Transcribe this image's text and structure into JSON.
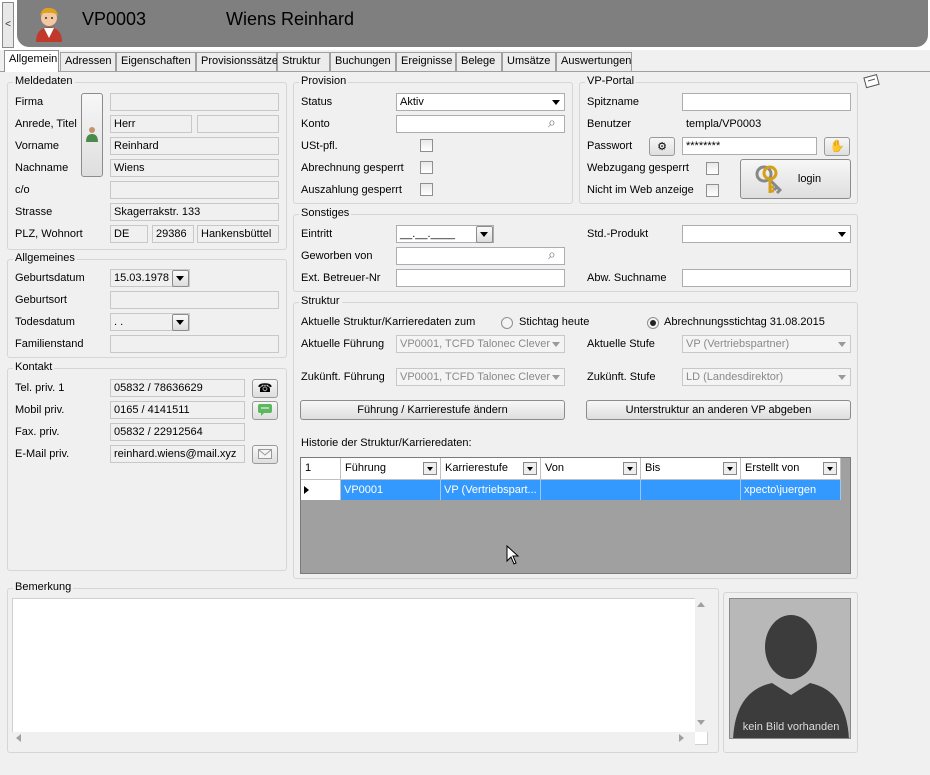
{
  "header": {
    "id": "VP0003",
    "name": "Wiens Reinhard",
    "collapse": "<"
  },
  "tabs": [
    "Allgemein",
    "Adressen",
    "Eigenschaften",
    "Provisionssätze",
    "Struktur",
    "Buchungen",
    "Ereignisse",
    "Belege",
    "Umsätze",
    "Auswertungen"
  ],
  "meldedaten": {
    "title": "Meldedaten",
    "firma_label": "Firma",
    "firma": "",
    "anrede_label": "Anrede, Titel",
    "anrede": "Herr",
    "titel": "",
    "vorname_label": "Vorname",
    "vorname": "Reinhard",
    "nachname_label": "Nachname",
    "nachname": "Wiens",
    "co_label": "c/o",
    "co": "",
    "strasse_label": "Strasse",
    "strasse": "Skagerrakstr. 133",
    "plz_label": "PLZ, Wohnort",
    "land": "DE",
    "plz": "29386",
    "ort": "Hankensbüttel"
  },
  "allgemeines": {
    "title": "Allgemeines",
    "geburtsdatum_label": "Geburtsdatum",
    "geburtsdatum": "15.03.1978",
    "geburtsort_label": "Geburtsort",
    "geburtsort": "",
    "todesdatum_label": "Todesdatum",
    "todesdatum": " .  .",
    "familienstand_label": "Familienstand",
    "familienstand": ""
  },
  "kontakt": {
    "title": "Kontakt",
    "tel_label": "Tel. priv. 1",
    "tel": "05832 / 78636629",
    "mobil_label": "Mobil priv.",
    "mobil": "0165 / 4141511",
    "fax_label": "Fax. priv.",
    "fax": "05832 / 22912564",
    "email_label": "E-Mail priv.",
    "email": "reinhard.wiens@mail.xyz"
  },
  "provision": {
    "title": "Provision",
    "status_label": "Status",
    "status": "Aktiv",
    "konto_label": "Konto",
    "konto": "",
    "ust_label": "USt-pfl.",
    "abrechnung_label": "Abrechnung gesperrt",
    "auszahlung_label": "Auszahlung gesperrt"
  },
  "portal": {
    "title": "VP-Portal",
    "spitzname_label": "Spitzname",
    "spitzname": "",
    "benutzer_label": "Benutzer",
    "benutzer": "templa/VP0003",
    "passwort_label": "Passwort",
    "passwort": "********",
    "webzugang_label": "Webzugang gesperrt",
    "nichtweb_label": "Nicht im Web anzeige",
    "login": "login"
  },
  "sonstiges": {
    "title": "Sonstiges",
    "eintritt_label": "Eintritt",
    "eintritt": "__.__.____",
    "geworben_label": "Geworben von",
    "geworben": "",
    "extbetreuer_label": "Ext. Betreuer-Nr",
    "extbetreuer": "",
    "stdprodukt_label": "Std.-Produkt",
    "stdprodukt": "",
    "abwsuchname_label": "Abw. Suchname",
    "abwsuchname": ""
  },
  "struktur": {
    "title": "Struktur",
    "aktuelle_zum_label": "Aktuelle Struktur/Karrieredaten zum",
    "radio_heute": "Stichtag heute",
    "radio_abrechnung": "Abrechnungsstichtag 31.08.2015",
    "fuehrung_label": "Aktuelle Führung",
    "fuehrung": "VP0001, TCFD Talonec Clever",
    "stufe_label": "Aktuelle Stufe",
    "stufe": "VP (Vertriebspartner)",
    "zfuehrung_label": "Zukünft. Führung",
    "zfuehrung": "VP0001, TCFD Talonec Clever",
    "zstufe_label": "Zukünft. Stufe",
    "zstufe": "LD (Landesdirektor)",
    "btn_aendern": "Führung / Karrierestufe ändern",
    "btn_abgeben": "Unterstruktur an anderen VP abgeben",
    "historie_label": "Historie der Struktur/Karrieredaten:"
  },
  "history": {
    "count": "1",
    "columns": [
      "Führung",
      "Karrierestufe",
      "Von",
      "Bis",
      "Erstellt von"
    ],
    "rows": [
      [
        "VP0001",
        "VP (Vertriebspart...",
        "",
        "",
        "xpecto\\juergen"
      ]
    ]
  },
  "bemerkung": {
    "title": "Bemerkung",
    "text": ""
  },
  "photo": {
    "caption": "kein Bild vorhanden"
  }
}
